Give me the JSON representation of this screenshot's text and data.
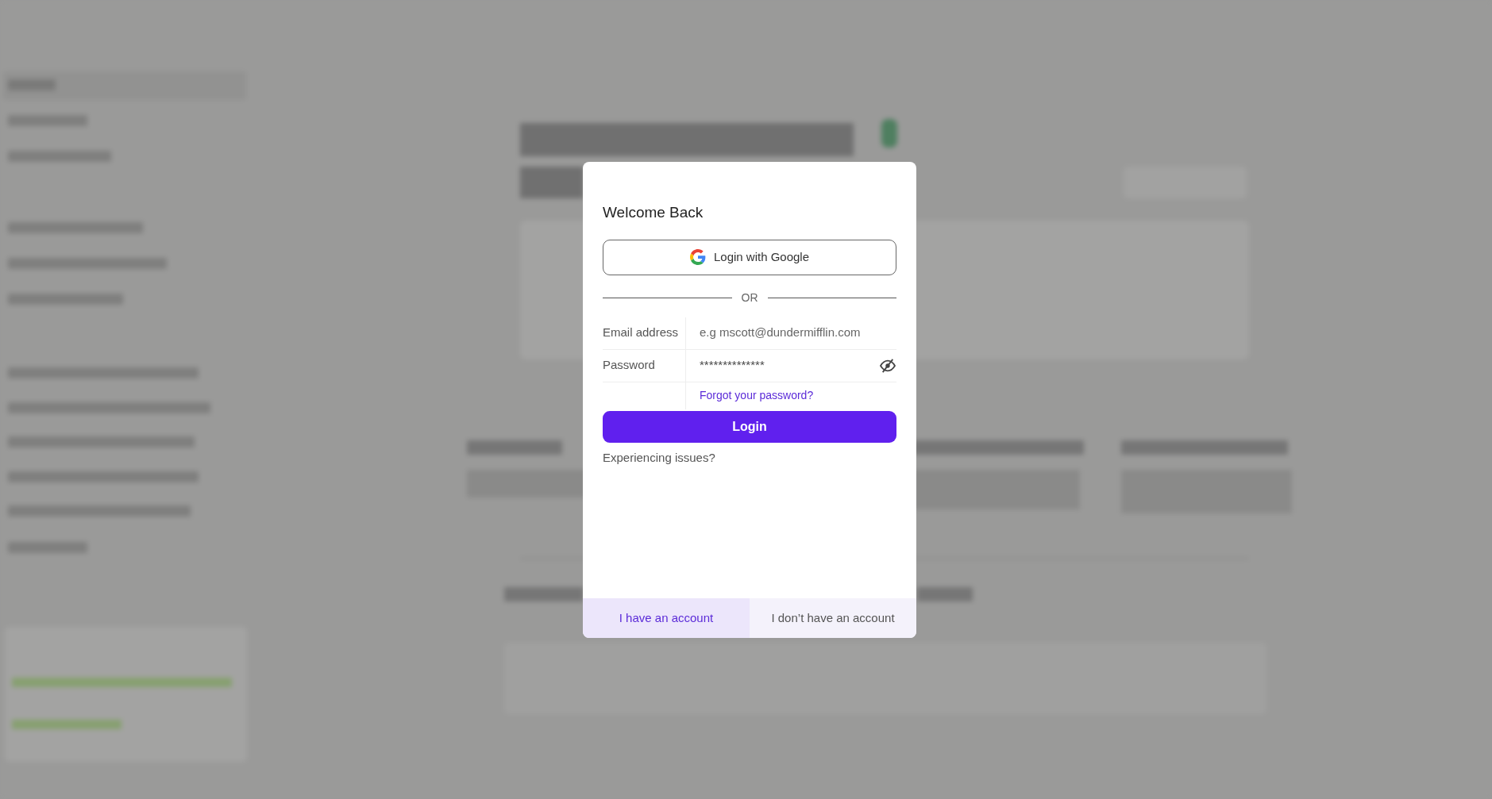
{
  "dialog": {
    "title": "Welcome Back",
    "google_button": {
      "label": "Login with Google"
    },
    "divider": "OR",
    "fields": [
      {
        "kind": "email",
        "label": "Email address",
        "placeholder": "e.g mscott@dundermifflin.com"
      },
      {
        "kind": "password",
        "label": "Password",
        "value": "**************"
      }
    ],
    "forgot_link": "Forgot your password?",
    "login_button": "Login",
    "issues_text": "Experiencing issues?",
    "tabs": [
      {
        "label": "I have an account",
        "selected": true
      },
      {
        "label": "I don’t have an account",
        "selected": false
      }
    ]
  }
}
